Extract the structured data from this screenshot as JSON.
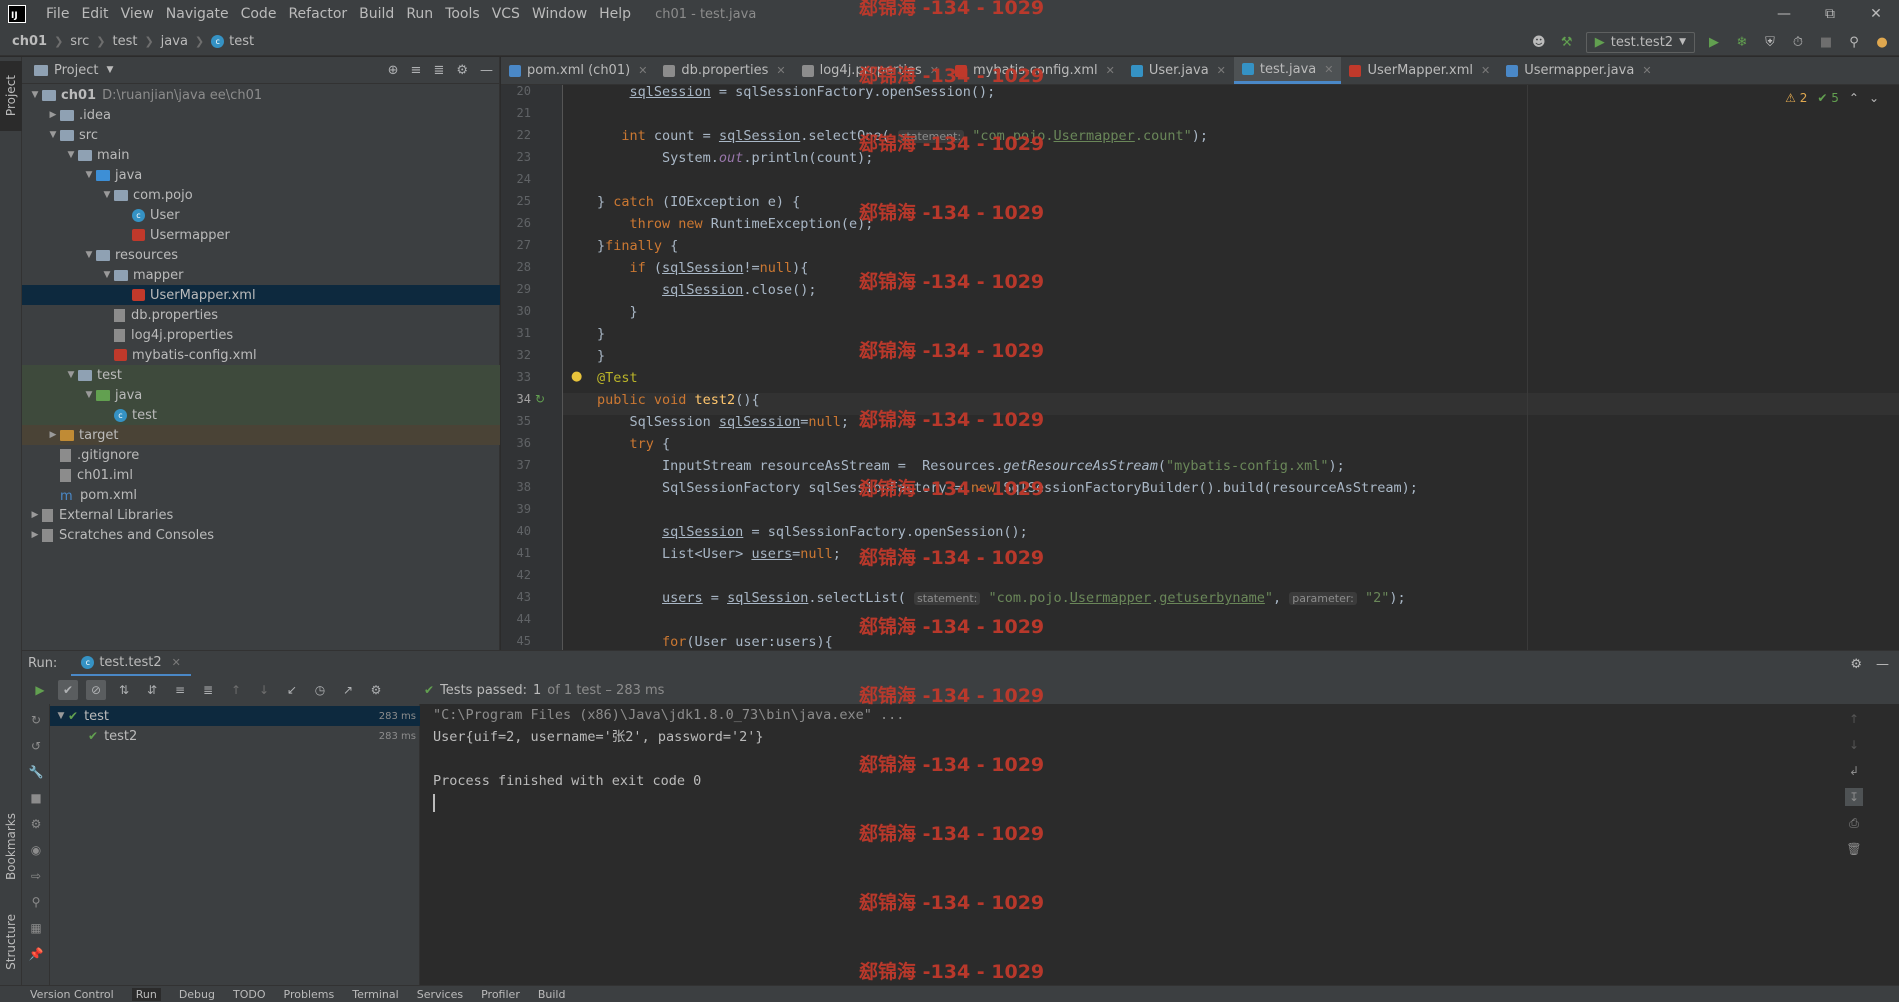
{
  "window": {
    "logo": "IJ",
    "title": "ch01 - test.java",
    "menu": [
      "File",
      "Edit",
      "View",
      "Navigate",
      "Code",
      "Refactor",
      "Build",
      "Run",
      "Tools",
      "VCS",
      "Window",
      "Help"
    ]
  },
  "breadcrumb": [
    "ch01",
    "src",
    "test",
    "java",
    "test"
  ],
  "run_config": "test.test2",
  "project": {
    "title": "Project",
    "tree": [
      {
        "label": "ch01",
        "path": "D:\\ruanjian\\java ee\\ch01",
        "depth": 0,
        "arrow": "down",
        "icon": "folder"
      },
      {
        "label": ".idea",
        "depth": 1,
        "arrow": "right",
        "icon": "folder"
      },
      {
        "label": "src",
        "depth": 1,
        "arrow": "down",
        "icon": "folder"
      },
      {
        "label": "main",
        "depth": 2,
        "arrow": "down",
        "icon": "folder"
      },
      {
        "label": "java",
        "depth": 3,
        "arrow": "down",
        "icon": "folder-blue"
      },
      {
        "label": "com.pojo",
        "depth": 4,
        "arrow": "down",
        "icon": "folder"
      },
      {
        "label": "User",
        "depth": 5,
        "arrow": "",
        "icon": "class"
      },
      {
        "label": "Usermapper",
        "depth": 5,
        "arrow": "",
        "icon": "mapper"
      },
      {
        "label": "resources",
        "depth": 3,
        "arrow": "down",
        "icon": "folder-res"
      },
      {
        "label": "mapper",
        "depth": 4,
        "arrow": "down",
        "icon": "folder"
      },
      {
        "label": "UserMapper.xml",
        "depth": 5,
        "arrow": "",
        "icon": "xml",
        "selected": true
      },
      {
        "label": "db.properties",
        "depth": 4,
        "arrow": "",
        "icon": "file"
      },
      {
        "label": "log4j.properties",
        "depth": 4,
        "arrow": "",
        "icon": "file"
      },
      {
        "label": "mybatis-config.xml",
        "depth": 4,
        "arrow": "",
        "icon": "xml"
      },
      {
        "label": "test",
        "depth": 2,
        "arrow": "down",
        "icon": "folder",
        "bg": "test"
      },
      {
        "label": "java",
        "depth": 3,
        "arrow": "down",
        "icon": "folder-green",
        "bg": "test"
      },
      {
        "label": "test",
        "depth": 4,
        "arrow": "",
        "icon": "class",
        "bg": "test"
      },
      {
        "label": "target",
        "depth": 1,
        "arrow": "right",
        "icon": "folder-orange",
        "bg": "target"
      },
      {
        "label": ".gitignore",
        "depth": 1,
        "arrow": "",
        "icon": "file"
      },
      {
        "label": "ch01.iml",
        "depth": 1,
        "arrow": "",
        "icon": "file"
      },
      {
        "label": "pom.xml",
        "depth": 1,
        "arrow": "",
        "icon": "maven"
      },
      {
        "label": "External Libraries",
        "depth": 0,
        "arrow": "right",
        "icon": "lib"
      },
      {
        "label": "Scratches and Consoles",
        "depth": 0,
        "arrow": "right",
        "icon": "scratch"
      }
    ]
  },
  "editor_tabs": [
    {
      "label": "pom.xml (ch01)",
      "color": "#4a88c7"
    },
    {
      "label": "db.properties",
      "color": "#8c8c8c"
    },
    {
      "label": "log4j.properties",
      "color": "#8c8c8c"
    },
    {
      "label": "mybatis-config.xml",
      "color": "#c0392b"
    },
    {
      "label": "User.java",
      "color": "#3592c4"
    },
    {
      "label": "test.java",
      "color": "#3592c4",
      "active": true
    },
    {
      "label": "UserMapper.xml",
      "color": "#c0392b"
    },
    {
      "label": "Usermapper.java",
      "color": "#4a88c7"
    }
  ],
  "inspections": {
    "warnings": "2",
    "ok": "5"
  },
  "code": {
    "line_numbers": [
      "20",
      "21",
      "22",
      "23",
      "24",
      "25",
      "26",
      "27",
      "28",
      "29",
      "30",
      "31",
      "32",
      "33",
      "34",
      "35",
      "36",
      "37",
      "38",
      "39",
      "40",
      "41",
      "42",
      "43",
      "44",
      "45"
    ],
    "hint_statement": "statement:",
    "hint_parameter": "parameter:"
  },
  "run": {
    "title": "Run:",
    "tab": "test.test2",
    "tests_passed_label": "Tests passed:",
    "tests_passed_count": "1",
    "tests_passed_detail": "of 1 test – 283 ms",
    "tree": [
      {
        "label": "test",
        "time": "283 ms",
        "depth": 0
      },
      {
        "label": "test2",
        "time": "283 ms",
        "depth": 1
      }
    ],
    "console": [
      "\"C:\\Program Files (x86)\\Java\\jdk1.8.0_73\\bin\\java.exe\" ...",
      "User{uif=2, username='张2', password='2'}",
      "",
      "Process finished with exit code 0"
    ]
  },
  "bottom_tools": [
    "Version Control",
    "Run",
    "Debug",
    "TODO",
    "Problems",
    "Terminal",
    "Services",
    "Profiler",
    "Build"
  ],
  "side_tabs": {
    "project": "Project",
    "bookmarks": "Bookmarks",
    "structure": "Structure"
  },
  "watermark": "郄锦海 -134 - 1029"
}
